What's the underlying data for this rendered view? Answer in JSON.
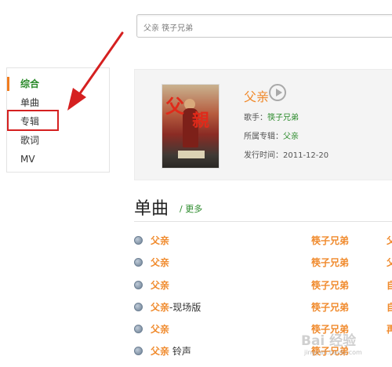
{
  "search": {
    "value": "父亲 筷子兄弟"
  },
  "sidebar": {
    "items": [
      {
        "label": "综合",
        "active": true
      },
      {
        "label": "单曲"
      },
      {
        "label": "专辑"
      },
      {
        "label": "歌词"
      },
      {
        "label": "MV"
      }
    ]
  },
  "album": {
    "title": "父亲",
    "singer_label": "歌手：",
    "singer": "筷子兄弟",
    "album_label": "所属专辑：",
    "album": "父亲",
    "release_label": "发行时间：",
    "release": "2011-12-20",
    "cover_text": "父亲"
  },
  "songs": {
    "title": "单曲",
    "more": "/ 更多",
    "rows": [
      {
        "song": "父亲",
        "suffix": "",
        "artist": "筷子兄弟",
        "clip": "父"
      },
      {
        "song": "父亲",
        "suffix": "",
        "artist": "筷子兄弟",
        "clip": "父"
      },
      {
        "song": "父亲",
        "suffix": "",
        "artist": "筷子兄弟",
        "clip": "自"
      },
      {
        "song": "父亲",
        "suffix": "-现场版",
        "artist": "筷子兄弟",
        "clip": "自"
      },
      {
        "song": "父亲",
        "suffix": "",
        "artist": "筷子兄弟",
        "clip": "再"
      },
      {
        "song": "父亲",
        "suffix": " 铃声",
        "artist": "筷子兄弟",
        "clip": ""
      }
    ]
  },
  "watermark": {
    "main": "Bai 经验",
    "sub": "jingyan.baidu.com"
  },
  "colors": {
    "accent": "#f08a2c",
    "link": "#2a8a2a",
    "annotation": "#d52020"
  }
}
